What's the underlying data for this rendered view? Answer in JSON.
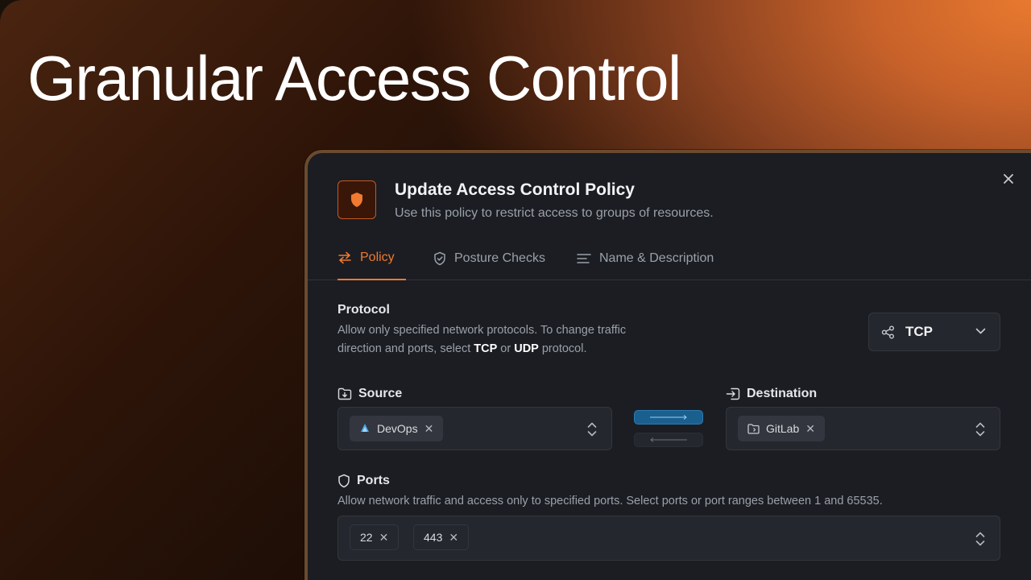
{
  "hero": {
    "title": "Granular Access Control"
  },
  "modal": {
    "title": "Update Access Control Policy",
    "subtitle": "Use this policy to restrict access to groups of resources.",
    "icon": "shield-icon",
    "tabs": [
      {
        "label": "Policy",
        "icon": "arrows-icon",
        "active": true
      },
      {
        "label": "Posture Checks",
        "icon": "shield-check-icon",
        "active": false
      },
      {
        "label": "Name & Description",
        "icon": "text-lines-icon",
        "active": false
      }
    ],
    "protocol": {
      "label": "Protocol",
      "desc_line1": "Allow only specified network protocols. To change traffic",
      "desc_line2_pre": "direction and ports, select ",
      "desc_tcp": "TCP",
      "desc_or": " or ",
      "desc_udp": "UDP",
      "desc_post": " protocol.",
      "selected": "TCP"
    },
    "source": {
      "label": "Source",
      "chip": "DevOps"
    },
    "destination": {
      "label": "Destination",
      "chip": "GitLab"
    },
    "ports": {
      "label": "Ports",
      "desc": "Allow network traffic and access only to specified ports. Select ports or port ranges between 1 and 65535.",
      "values": [
        "22",
        "443"
      ]
    }
  },
  "colors": {
    "accent": "#f07a30",
    "modal_bg": "#1b1d22",
    "direction_active": "#1b5f8f"
  }
}
